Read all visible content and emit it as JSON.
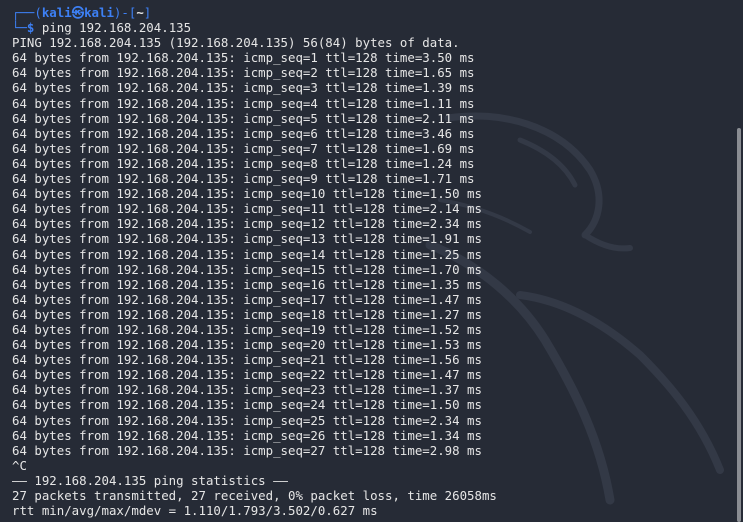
{
  "prompt": {
    "box_top": "┌──(",
    "user": "kali",
    "at_glyph": "㉿",
    "host": "kali",
    "box_mid": ")-[",
    "path": "~",
    "box_end": "]",
    "box_bottom": "└─",
    "dollar": "$",
    "command": "ping",
    "argument": "192.168.204.135"
  },
  "output": {
    "header": "PING 192.168.204.135 (192.168.204.135) 56(84) bytes of data.",
    "replies": [
      "64 bytes from 192.168.204.135: icmp_seq=1 ttl=128 time=3.50 ms",
      "64 bytes from 192.168.204.135: icmp_seq=2 ttl=128 time=1.65 ms",
      "64 bytes from 192.168.204.135: icmp_seq=3 ttl=128 time=1.39 ms",
      "64 bytes from 192.168.204.135: icmp_seq=4 ttl=128 time=1.11 ms",
      "64 bytes from 192.168.204.135: icmp_seq=5 ttl=128 time=2.11 ms",
      "64 bytes from 192.168.204.135: icmp_seq=6 ttl=128 time=3.46 ms",
      "64 bytes from 192.168.204.135: icmp_seq=7 ttl=128 time=1.69 ms",
      "64 bytes from 192.168.204.135: icmp_seq=8 ttl=128 time=1.24 ms",
      "64 bytes from 192.168.204.135: icmp_seq=9 ttl=128 time=1.71 ms",
      "64 bytes from 192.168.204.135: icmp_seq=10 ttl=128 time=1.50 ms",
      "64 bytes from 192.168.204.135: icmp_seq=11 ttl=128 time=2.14 ms",
      "64 bytes from 192.168.204.135: icmp_seq=12 ttl=128 time=2.34 ms",
      "64 bytes from 192.168.204.135: icmp_seq=13 ttl=128 time=1.91 ms",
      "64 bytes from 192.168.204.135: icmp_seq=14 ttl=128 time=1.25 ms",
      "64 bytes from 192.168.204.135: icmp_seq=15 ttl=128 time=1.70 ms",
      "64 bytes from 192.168.204.135: icmp_seq=16 ttl=128 time=1.35 ms",
      "64 bytes from 192.168.204.135: icmp_seq=17 ttl=128 time=1.47 ms",
      "64 bytes from 192.168.204.135: icmp_seq=18 ttl=128 time=1.27 ms",
      "64 bytes from 192.168.204.135: icmp_seq=19 ttl=128 time=1.52 ms",
      "64 bytes from 192.168.204.135: icmp_seq=20 ttl=128 time=1.53 ms",
      "64 bytes from 192.168.204.135: icmp_seq=21 ttl=128 time=1.56 ms",
      "64 bytes from 192.168.204.135: icmp_seq=22 ttl=128 time=1.47 ms",
      "64 bytes from 192.168.204.135: icmp_seq=23 ttl=128 time=1.37 ms",
      "64 bytes from 192.168.204.135: icmp_seq=24 ttl=128 time=1.50 ms",
      "64 bytes from 192.168.204.135: icmp_seq=25 ttl=128 time=2.34 ms",
      "64 bytes from 192.168.204.135: icmp_seq=26 ttl=128 time=1.34 ms",
      "64 bytes from 192.168.204.135: icmp_seq=27 ttl=128 time=2.98 ms"
    ],
    "interrupt": "^C",
    "stats_header": "—— 192.168.204.135 ping statistics ——",
    "stats_packets": "27 packets transmitted, 27 received, 0% packet loss, time 26058ms",
    "stats_rtt": "rtt min/avg/max/mdev = 1.110/1.793/3.502/0.627 ms"
  },
  "colors": {
    "background": "#262b36",
    "prompt_blue": "#3d80f5",
    "text": "#e6e6e6"
  },
  "icons": {
    "background_logo": "kali-dragon-icon"
  }
}
